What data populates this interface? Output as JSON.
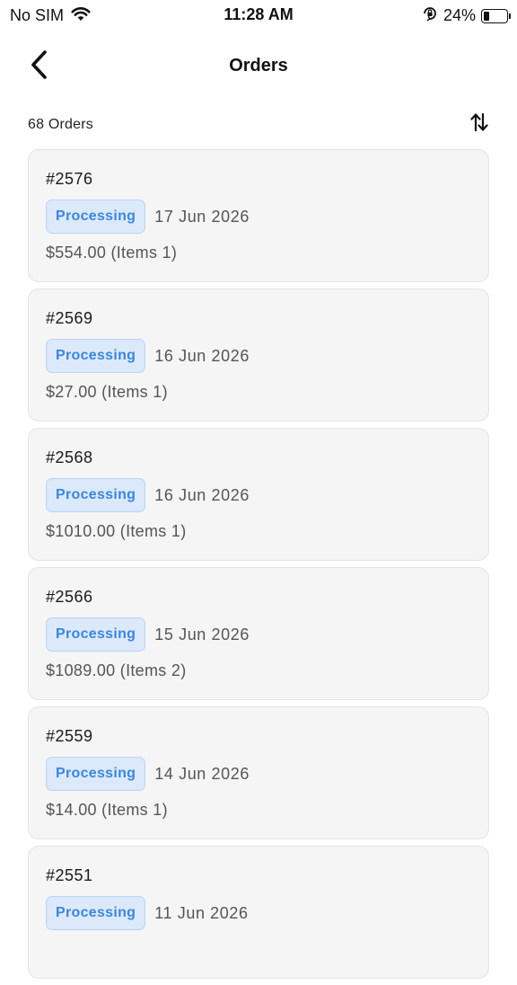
{
  "status_bar": {
    "carrier": "No SIM",
    "time": "11:28 AM",
    "battery_percent": "24%",
    "battery_level": 0.24
  },
  "nav": {
    "title": "Orders",
    "back_icon": "chevron-left-icon"
  },
  "list_header": {
    "count_label": "68 Orders",
    "sort_icon": "sort-arrows-icon"
  },
  "colors": {
    "card_background": "#f5f5f5",
    "badge_background": "#dbe9fb",
    "badge_text": "#3c86dc"
  },
  "orders": [
    {
      "number": "#2576",
      "status": "Processing",
      "date": "17 Jun 2026",
      "summary": "$554.00 (Items 1)"
    },
    {
      "number": "#2569",
      "status": "Processing",
      "date": "16 Jun 2026",
      "summary": "$27.00 (Items 1)"
    },
    {
      "number": "#2568",
      "status": "Processing",
      "date": "16 Jun 2026",
      "summary": "$1010.00 (Items 1)"
    },
    {
      "number": "#2566",
      "status": "Processing",
      "date": "15 Jun 2026",
      "summary": "$1089.00 (Items 2)"
    },
    {
      "number": "#2559",
      "status": "Processing",
      "date": "14 Jun 2026",
      "summary": "$14.00 (Items 1)"
    },
    {
      "number": "#2551",
      "status": "Processing",
      "date": "11 Jun 2026",
      "summary": ""
    }
  ]
}
